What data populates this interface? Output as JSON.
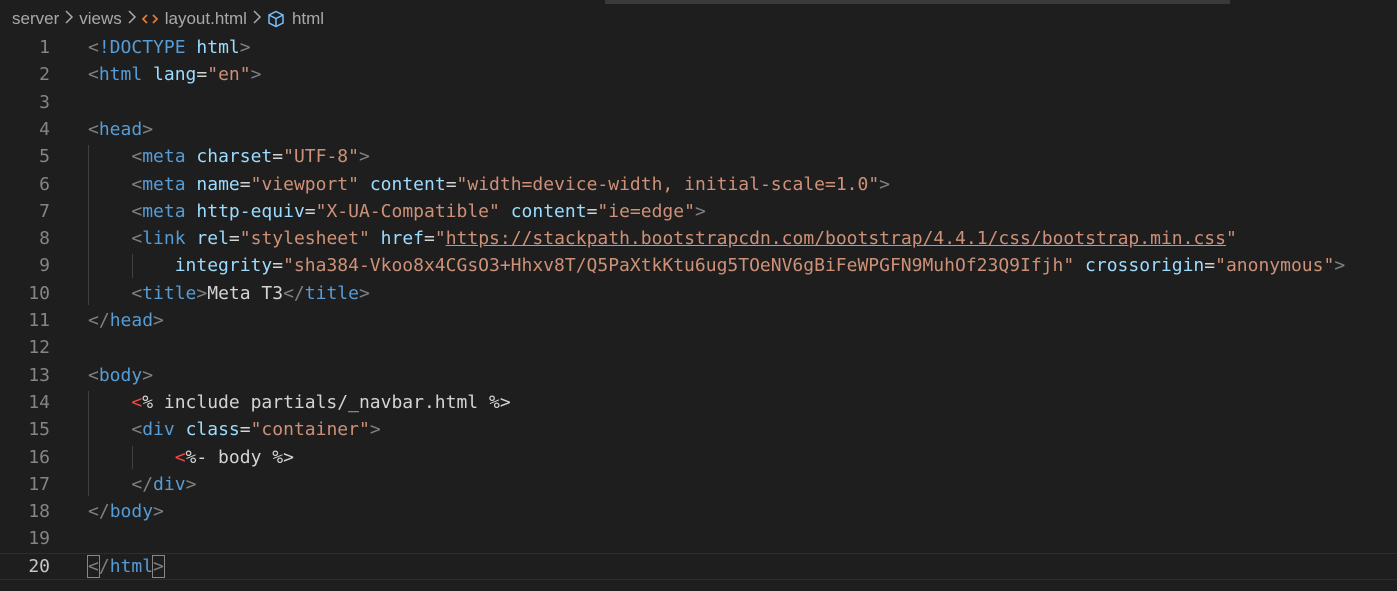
{
  "breadcrumb": {
    "items": [
      "server",
      "views",
      "layout.html",
      "html"
    ],
    "icons": [
      "",
      "",
      "code-brackets-icon",
      "cube-icon"
    ],
    "separator": ">"
  },
  "editor": {
    "active_line": 20,
    "lines": [
      {
        "n": "1",
        "tokens": [
          {
            "t": "<",
            "c": "t-punc"
          },
          {
            "t": "!DOCTYPE",
            "c": "t-tag"
          },
          {
            "t": " ",
            "c": "t-text"
          },
          {
            "t": "html",
            "c": "t-attr"
          },
          {
            "t": ">",
            "c": "t-punc"
          }
        ]
      },
      {
        "n": "2",
        "tokens": [
          {
            "t": "<",
            "c": "t-punc"
          },
          {
            "t": "html",
            "c": "t-tag"
          },
          {
            "t": " ",
            "c": "t-text"
          },
          {
            "t": "lang",
            "c": "t-attr"
          },
          {
            "t": "=",
            "c": "t-eq"
          },
          {
            "t": "\"en\"",
            "c": "t-str"
          },
          {
            "t": ">",
            "c": "t-punc"
          }
        ]
      },
      {
        "n": "3",
        "tokens": []
      },
      {
        "n": "4",
        "tokens": [
          {
            "t": "<",
            "c": "t-punc"
          },
          {
            "t": "head",
            "c": "t-tag"
          },
          {
            "t": ">",
            "c": "t-punc"
          }
        ]
      },
      {
        "n": "5",
        "tokens": [
          {
            "t": "    ",
            "c": "t-text"
          },
          {
            "t": "<",
            "c": "t-punc"
          },
          {
            "t": "meta",
            "c": "t-tag"
          },
          {
            "t": " ",
            "c": "t-text"
          },
          {
            "t": "charset",
            "c": "t-attr"
          },
          {
            "t": "=",
            "c": "t-eq"
          },
          {
            "t": "\"UTF-8\"",
            "c": "t-str"
          },
          {
            "t": ">",
            "c": "t-punc"
          }
        ]
      },
      {
        "n": "6",
        "tokens": [
          {
            "t": "    ",
            "c": "t-text"
          },
          {
            "t": "<",
            "c": "t-punc"
          },
          {
            "t": "meta",
            "c": "t-tag"
          },
          {
            "t": " ",
            "c": "t-text"
          },
          {
            "t": "name",
            "c": "t-attr"
          },
          {
            "t": "=",
            "c": "t-eq"
          },
          {
            "t": "\"viewport\"",
            "c": "t-str"
          },
          {
            "t": " ",
            "c": "t-text"
          },
          {
            "t": "content",
            "c": "t-attr"
          },
          {
            "t": "=",
            "c": "t-eq"
          },
          {
            "t": "\"width=device-width, initial-scale=1.0\"",
            "c": "t-str"
          },
          {
            "t": ">",
            "c": "t-punc"
          }
        ]
      },
      {
        "n": "7",
        "tokens": [
          {
            "t": "    ",
            "c": "t-text"
          },
          {
            "t": "<",
            "c": "t-punc"
          },
          {
            "t": "meta",
            "c": "t-tag"
          },
          {
            "t": " ",
            "c": "t-text"
          },
          {
            "t": "http-equiv",
            "c": "t-attr"
          },
          {
            "t": "=",
            "c": "t-eq"
          },
          {
            "t": "\"X-UA-Compatible\"",
            "c": "t-str"
          },
          {
            "t": " ",
            "c": "t-text"
          },
          {
            "t": "content",
            "c": "t-attr"
          },
          {
            "t": "=",
            "c": "t-eq"
          },
          {
            "t": "\"ie=edge\"",
            "c": "t-str"
          },
          {
            "t": ">",
            "c": "t-punc"
          }
        ]
      },
      {
        "n": "8",
        "tokens": [
          {
            "t": "    ",
            "c": "t-text"
          },
          {
            "t": "<",
            "c": "t-punc"
          },
          {
            "t": "link",
            "c": "t-tag"
          },
          {
            "t": " ",
            "c": "t-text"
          },
          {
            "t": "rel",
            "c": "t-attr"
          },
          {
            "t": "=",
            "c": "t-eq"
          },
          {
            "t": "\"stylesheet\"",
            "c": "t-str"
          },
          {
            "t": " ",
            "c": "t-text"
          },
          {
            "t": "href",
            "c": "t-attr"
          },
          {
            "t": "=",
            "c": "t-eq"
          },
          {
            "t": "\"",
            "c": "t-str"
          },
          {
            "t": "https://stackpath.bootstrapcdn.com/bootstrap/4.4.1/css/bootstrap.min.css",
            "c": "t-str t-url"
          },
          {
            "t": "\"",
            "c": "t-str"
          }
        ]
      },
      {
        "n": "9",
        "tokens": [
          {
            "t": "        ",
            "c": "t-text"
          },
          {
            "t": "integrity",
            "c": "t-attr"
          },
          {
            "t": "=",
            "c": "t-eq"
          },
          {
            "t": "\"sha384-Vkoo8x4CGsO3+Hhxv8T/Q5PaXtkKtu6ug5TOeNV6gBiFeWPGFN9MuhOf23Q9Ifjh\"",
            "c": "t-str"
          },
          {
            "t": " ",
            "c": "t-text"
          },
          {
            "t": "crossorigin",
            "c": "t-attr"
          },
          {
            "t": "=",
            "c": "t-eq"
          },
          {
            "t": "\"anonymous\"",
            "c": "t-str"
          },
          {
            "t": ">",
            "c": "t-punc"
          }
        ]
      },
      {
        "n": "10",
        "tokens": [
          {
            "t": "    ",
            "c": "t-text"
          },
          {
            "t": "<",
            "c": "t-punc"
          },
          {
            "t": "title",
            "c": "t-tag"
          },
          {
            "t": ">",
            "c": "t-punc"
          },
          {
            "t": "Meta T3",
            "c": "t-text"
          },
          {
            "t": "</",
            "c": "t-punc"
          },
          {
            "t": "title",
            "c": "t-tag"
          },
          {
            "t": ">",
            "c": "t-punc"
          }
        ]
      },
      {
        "n": "11",
        "tokens": [
          {
            "t": "</",
            "c": "t-punc"
          },
          {
            "t": "head",
            "c": "t-tag"
          },
          {
            "t": ">",
            "c": "t-punc"
          }
        ]
      },
      {
        "n": "12",
        "tokens": []
      },
      {
        "n": "13",
        "tokens": [
          {
            "t": "<",
            "c": "t-punc"
          },
          {
            "t": "body",
            "c": "t-tag"
          },
          {
            "t": ">",
            "c": "t-punc"
          }
        ]
      },
      {
        "n": "14",
        "tokens": [
          {
            "t": "    ",
            "c": "t-text"
          },
          {
            "t": "<",
            "c": "t-ejs"
          },
          {
            "t": "% include partials/_navbar.html %>",
            "c": "t-text"
          }
        ]
      },
      {
        "n": "15",
        "tokens": [
          {
            "t": "    ",
            "c": "t-text"
          },
          {
            "t": "<",
            "c": "t-punc"
          },
          {
            "t": "div",
            "c": "t-tag"
          },
          {
            "t": " ",
            "c": "t-text"
          },
          {
            "t": "class",
            "c": "t-attr"
          },
          {
            "t": "=",
            "c": "t-eq"
          },
          {
            "t": "\"container\"",
            "c": "t-str"
          },
          {
            "t": ">",
            "c": "t-punc"
          }
        ]
      },
      {
        "n": "16",
        "tokens": [
          {
            "t": "        ",
            "c": "t-text"
          },
          {
            "t": "<",
            "c": "t-ejs"
          },
          {
            "t": "%- body %>",
            "c": "t-text"
          }
        ]
      },
      {
        "n": "17",
        "tokens": [
          {
            "t": "    ",
            "c": "t-text"
          },
          {
            "t": "</",
            "c": "t-punc"
          },
          {
            "t": "div",
            "c": "t-tag"
          },
          {
            "t": ">",
            "c": "t-punc"
          }
        ]
      },
      {
        "n": "18",
        "tokens": [
          {
            "t": "</",
            "c": "t-punc"
          },
          {
            "t": "body",
            "c": "t-tag"
          },
          {
            "t": ">",
            "c": "t-punc"
          }
        ]
      },
      {
        "n": "19",
        "tokens": []
      },
      {
        "n": "20",
        "tokens": [
          {
            "t": "<",
            "c": "t-punc bracket-box"
          },
          {
            "t": "/",
            "c": "t-punc"
          },
          {
            "t": "html",
            "c": "t-tag"
          },
          {
            "t": ">",
            "c": "t-punc bracket-box"
          }
        ]
      }
    ]
  }
}
